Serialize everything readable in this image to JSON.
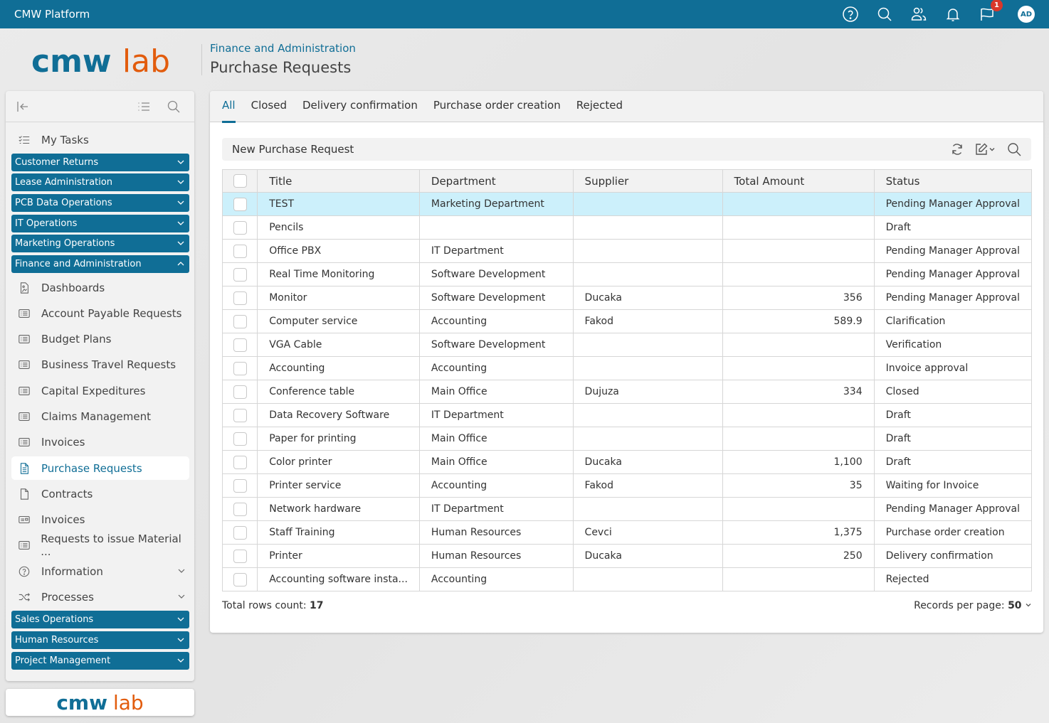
{
  "app": {
    "title": "CMW Platform"
  },
  "topbar": {
    "icons": [
      "help-icon",
      "search-icon",
      "users-icon",
      "bell-icon",
      "chat-flag-icon"
    ],
    "notification_count": "1",
    "avatar_initials": "AD"
  },
  "logo": {
    "part1": "cmw",
    "part2": "lab"
  },
  "header": {
    "breadcrumb": "Finance and Administration",
    "title": "Purchase Requests"
  },
  "sidebar": {
    "my_tasks": "My Tasks",
    "groups_top": [
      {
        "label": "Customer Returns",
        "expanded": false
      },
      {
        "label": "Lease Administration",
        "expanded": false
      },
      {
        "label": "PCB Data Operations",
        "expanded": false
      },
      {
        "label": "IT Operations",
        "expanded": false
      },
      {
        "label": "Marketing Operations",
        "expanded": false
      },
      {
        "label": "Finance and Administration",
        "expanded": true
      }
    ],
    "items": [
      {
        "label": "Dashboards",
        "icon": "dashboard-icon"
      },
      {
        "label": "Account Payable Requests",
        "icon": "list-icon"
      },
      {
        "label": "Budget Plans",
        "icon": "list-icon"
      },
      {
        "label": "Business Travel Requests",
        "icon": "list-icon"
      },
      {
        "label": "Capital Expeditures",
        "icon": "list-icon"
      },
      {
        "label": "Claims Management",
        "icon": "list-icon"
      },
      {
        "label": "Invoices",
        "icon": "list-icon"
      },
      {
        "label": "Purchase Requests",
        "icon": "document-icon",
        "active": true
      },
      {
        "label": "Contracts",
        "icon": "file-icon"
      },
      {
        "label": "Invoices",
        "icon": "card-icon"
      },
      {
        "label": "Requests to issue Material ...",
        "icon": "list-icon"
      },
      {
        "label": "Information",
        "icon": "help-circle-icon"
      },
      {
        "label": "Processes",
        "icon": "shuffle-icon"
      }
    ],
    "groups_bottom": [
      {
        "label": "Sales Operations",
        "expanded": false
      },
      {
        "label": "Human Resources",
        "expanded": false
      },
      {
        "label": "Project Management",
        "expanded": false
      }
    ]
  },
  "tabs": [
    {
      "label": "All",
      "active": true
    },
    {
      "label": "Closed"
    },
    {
      "label": "Delivery confirmation"
    },
    {
      "label": "Purchase order creation"
    },
    {
      "label": "Rejected"
    }
  ],
  "toolbar": {
    "new_label": "New Purchase Request"
  },
  "table": {
    "columns": [
      "Title",
      "Department",
      "Supplier",
      "Total Amount",
      "Status"
    ],
    "rows": [
      [
        "TEST",
        "Marketing Department",
        "",
        "",
        "Pending Manager Approval"
      ],
      [
        "Pencils",
        "",
        "",
        "",
        "Draft"
      ],
      [
        "Office PBX",
        "IT Department",
        "",
        "",
        "Pending Manager Approval"
      ],
      [
        "Real Time Monitoring",
        "Software Development",
        "",
        "",
        "Pending Manager Approval"
      ],
      [
        "Monitor",
        "Software Development",
        "Ducaka",
        "356",
        "Pending Manager Approval"
      ],
      [
        "Computer service",
        "Accounting",
        "Fakod",
        "589.9",
        "Clarification"
      ],
      [
        "VGA Cable",
        "Software Development",
        "",
        "",
        "Verification"
      ],
      [
        "Accounting",
        "Accounting",
        "",
        "",
        "Invoice approval"
      ],
      [
        "Conference table",
        "Main Office",
        "Dujuza",
        "334",
        "Closed"
      ],
      [
        "Data Recovery Software",
        "IT Department",
        "",
        "",
        "Draft"
      ],
      [
        "Paper for printing",
        "Main Office",
        "",
        "",
        "Draft"
      ],
      [
        "Color printer",
        "Main Office",
        "Ducaka",
        "1,100",
        "Draft"
      ],
      [
        "Printer service",
        "Accounting",
        "Fakod",
        "35",
        "Waiting for Invoice"
      ],
      [
        "Network hardware",
        "IT Department",
        "",
        "",
        "Pending Manager Approval"
      ],
      [
        "Staff Training",
        "Human Resources",
        "Cevci",
        "1,375",
        "Purchase order creation"
      ],
      [
        "Printer",
        "Human Resources",
        "Ducaka",
        "250",
        "Delivery confirmation"
      ],
      [
        "Accounting software insta...",
        "Accounting",
        "",
        "",
        "Rejected"
      ]
    ],
    "selected_row": 0
  },
  "footer": {
    "total_label": "Total rows count: ",
    "total_value": "17",
    "rpp_label": "Records per page: ",
    "rpp_value": "50"
  }
}
